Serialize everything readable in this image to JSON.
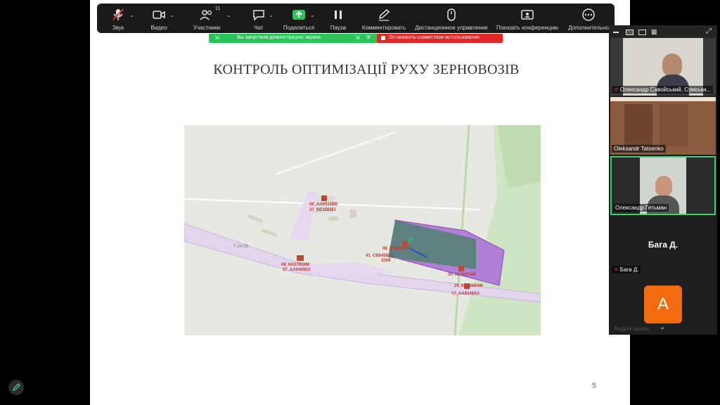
{
  "toolbar": {
    "items": [
      {
        "label": "Звук"
      },
      {
        "label": "Видео"
      },
      {
        "label": "Участники",
        "count": "11"
      },
      {
        "label": "Чат"
      },
      {
        "label": "Поделиться"
      },
      {
        "label": "Пауза"
      },
      {
        "label": "Комментировать"
      },
      {
        "label": "Дистанционное управление"
      },
      {
        "label": "Показать конференцию"
      },
      {
        "label": "Дополнительно"
      }
    ]
  },
  "share_banner": {
    "status": "Вы запустили демонстрацию экрана",
    "stop": "Остановить совместное использование"
  },
  "slide": {
    "title": "КОНТРОЛЬ ОПТИМІЗАЦІЇ РУХУ ЗЕРНОВОЗІВ",
    "page_number": "5",
    "map_labels": [
      "02_АА0511ВВ",
      "37_ВЕ3568ЕІ",
      "08_ВН6535АХ",
      "41_СВ6459АС",
      "3309",
      "09_КА2795КМ",
      "37_АА9460КХ",
      "35_КА1111АМ",
      "29_КА8569АМ",
      "17_АА8349ХА",
      "Т-24-06"
    ]
  },
  "gallery": {
    "participants": [
      {
        "name": "Олександр Савойський, Сумськи...",
        "muted": true
      },
      {
        "name": "Oleksandr Tatsenko",
        "muted": false
      },
      {
        "name": "Олександр Гетьман",
        "muted": false
      },
      {
        "name": "Бага Д.",
        "display": "Бага Д.",
        "muted": true
      },
      {
        "name": "Андрій Цьоко",
        "avatar_letter": "А",
        "avatar_color": "#f26b0f"
      }
    ]
  },
  "colors": {
    "toolbar_bg": "#1a1a1a",
    "share_green": "#29c35a",
    "share_red": "#e02828",
    "active_speaker": "#3bd36b",
    "zone_purple": "#9b59d0"
  }
}
